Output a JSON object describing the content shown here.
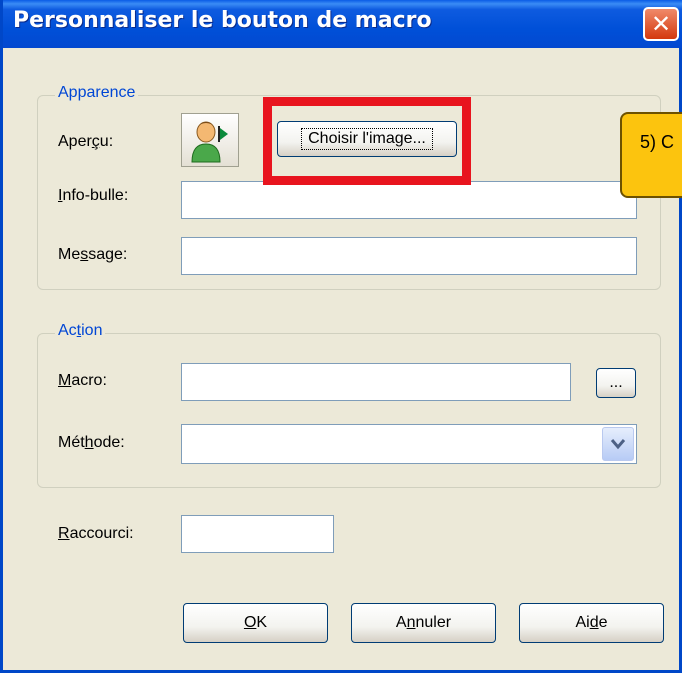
{
  "window": {
    "title": "Personnaliser le bouton de macro",
    "close_symbol": "✕"
  },
  "apparence": {
    "legend": "Apparence",
    "apercu_label": "Aperçu:",
    "choose_image_button": "Choisir l'image...",
    "infobulle_label": "Info-bulle:",
    "infobulle_value": "",
    "message_label": "Message:",
    "message_value": ""
  },
  "action": {
    "legend": "Action",
    "macro_label": "Macro:",
    "macro_value": "",
    "browse_button": "...",
    "methode_label": "Méthode:",
    "methode_value": ""
  },
  "raccourci": {
    "label": "Raccourci:",
    "value": ""
  },
  "footer": {
    "ok_label": "OK",
    "cancel_label": "Annuler",
    "help_label": "Aide"
  },
  "callout": {
    "text": "5) C"
  },
  "colors": {
    "title_bar": "#0050d8",
    "highlight_box": "#e8141e",
    "callout_fill": "#fcc40e",
    "legend_text": "#0046d5"
  }
}
